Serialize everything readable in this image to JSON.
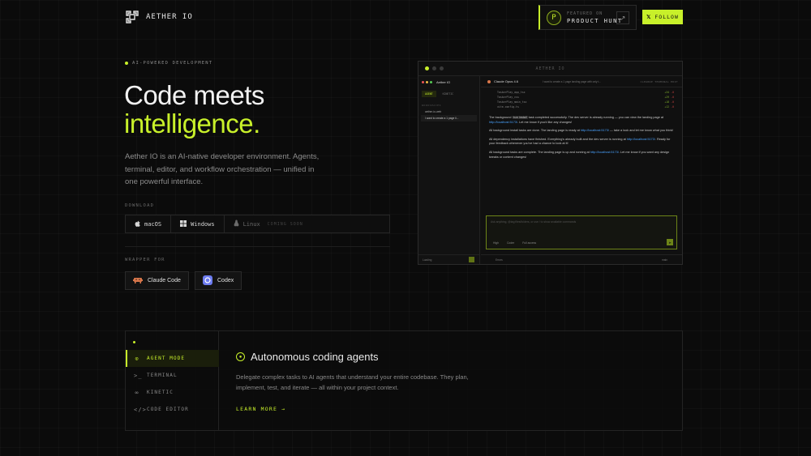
{
  "header": {
    "brand": "AETHER IO",
    "product_hunt": {
      "small": "FEATURED ON",
      "big": "PRODUCT HUNT",
      "badge": "P",
      "arrow": "↗"
    },
    "follow": {
      "icon": "x-icon",
      "label": "FOLLOW"
    }
  },
  "hero": {
    "tag": "AI-POWERED DEVELOPMENT",
    "title_line1": "Code meets",
    "title_line2": "intelligence.",
    "description": "Aether IO is an AI-native developer environment. Agents, terminal, editor, and workflow orchestration — unified in one powerful interface.",
    "download_label": "DOWNLOAD",
    "downloads": [
      {
        "label": "macOS",
        "icon": "apple-icon"
      },
      {
        "label": "Windows",
        "icon": "windows-icon"
      },
      {
        "label": "Linux",
        "icon": "linux-icon",
        "note": "COMING SOON"
      }
    ],
    "wrapper_label": "WRAPPER FOR",
    "wrappers": [
      {
        "label": "Claude Code",
        "icon": "claude-icon"
      },
      {
        "label": "Codex",
        "icon": "codex-icon"
      }
    ]
  },
  "app": {
    "window_title": "AETHER IO",
    "sidebar": {
      "title": "Aether IO",
      "tabs": [
        "AGENT",
        "KINETIC"
      ],
      "section": "WORKSPACES",
      "workspace": "aether-io-web",
      "session": "I want to create a 1 page li...",
      "footer": "Loading"
    },
    "main": {
      "model": "Claude Opus 4.6",
      "prompt_crumb": "I want to create a 1 page landing page with only t...",
      "right_tabs": "CLEANUP   TERMINAL   EDIT",
      "files": [
        {
          "name": "TaskerPlay_app_tsx",
          "plus": "+34",
          "minus": "-0"
        },
        {
          "name": "TaskerPlay_css",
          "plus": "+29",
          "minus": "-0"
        },
        {
          "name": "TaskerPlay_main_tsx",
          "plus": "+18",
          "minus": "-0"
        },
        {
          "name": "vite.config.ts",
          "plus": "+12",
          "minus": "-0"
        }
      ],
      "messages": [
        {
          "pre": "The background ",
          "code": "bun install",
          "mid": " task completed successfully. The dev server is already running — you can view the landing page at ",
          "link": "http://localhost:5173/",
          "post": ". Let me know if you'd like any changes!"
        },
        {
          "pre": "All background install tasks are done. The landing page is ready at ",
          "link": "http://localhost:5173/",
          "post": " — take a look and let me know what you think!"
        },
        {
          "pre": "All dependency installations have finished. Everything's already built and the dev server is running at ",
          "link": "http://localhost:5173/",
          "post": ". Ready for your feedback whenever you've had a chance to look at it!"
        },
        {
          "pre": "All background tasks are complete. The landing page is up and running at ",
          "link": "http://localhost:5173/",
          "post": ". Let me know if you want any design tweaks or content changes!"
        }
      ],
      "input_placeholder": "Ask anything, @tag files/folders, or use / to show available commands",
      "options": [
        "High",
        "Coder",
        "Full access"
      ],
      "footer_left": "Errors",
      "footer_right": "main"
    }
  },
  "features": {
    "items": [
      {
        "label": "AGENT MODE",
        "icon": "agent-icon"
      },
      {
        "label": "TERMINAL",
        "icon": "terminal-icon"
      },
      {
        "label": "KINETIC",
        "icon": "kinetic-icon"
      },
      {
        "label": "CODE EDITOR",
        "icon": "code-icon"
      }
    ],
    "title": "Autonomous coding agents",
    "description": "Delegate complex tasks to AI agents that understand your entire codebase. They plan, implement, test, and iterate — all within your project context.",
    "cta": "LEARN MORE →"
  },
  "colors": {
    "accent": "#c8f02a",
    "background": "#0b0b0b"
  }
}
